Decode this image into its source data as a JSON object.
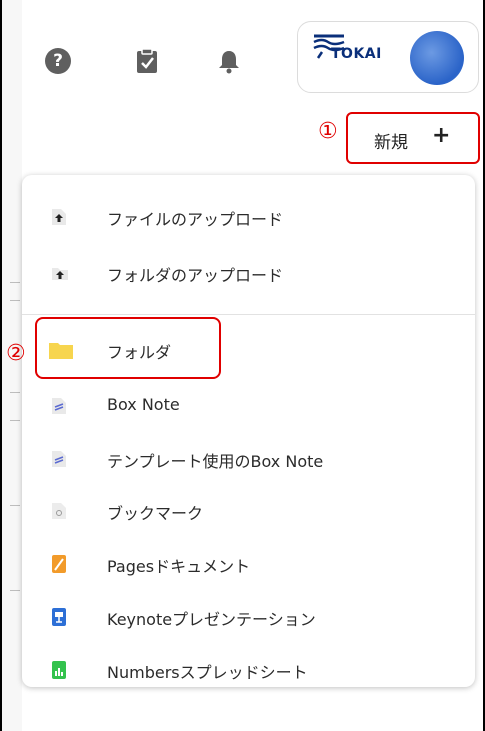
{
  "header": {
    "help_icon": "question-circle-icon",
    "help_glyph": "?",
    "tasks_icon": "clipboard-check-icon",
    "notifications_icon": "bell-icon",
    "org_logo_text": "TOKAI",
    "new_button_label": "新規",
    "new_button_plus": "+"
  },
  "annotations": {
    "marker_1": "①",
    "marker_2": "②",
    "highlight_color": "#e00000"
  },
  "menu": {
    "items": [
      {
        "label": "ファイルのアップロード",
        "icon": "file-upload-icon"
      },
      {
        "label": "フォルダのアップロード",
        "icon": "folder-upload-icon"
      },
      {
        "label": "フォルダ",
        "icon": "folder-icon"
      },
      {
        "label": "Box Note",
        "icon": "box-note-icon"
      },
      {
        "label": "テンプレート使用のBox Note",
        "icon": "box-note-template-icon"
      },
      {
        "label": "ブックマーク",
        "icon": "bookmark-icon"
      },
      {
        "label": "Pagesドキュメント",
        "icon": "pages-document-icon"
      },
      {
        "label": "Keynoteプレゼンテーション",
        "icon": "keynote-presentation-icon"
      },
      {
        "label": "Numbersスプレッドシート",
        "icon": "numbers-spreadsheet-icon"
      }
    ]
  },
  "colors": {
    "folder": "#f7d54e",
    "pages": "#f29b2a",
    "keynote": "#2d6fd6",
    "numbers": "#33c24d",
    "note": "#5b6bd1"
  }
}
